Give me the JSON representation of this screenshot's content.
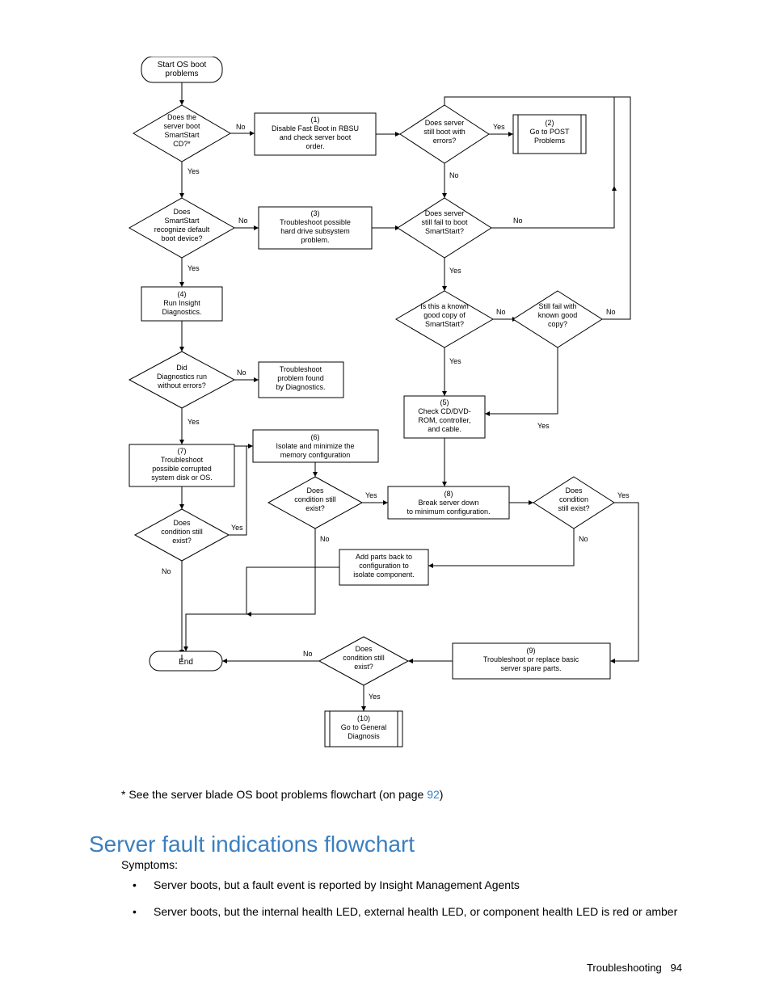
{
  "flow": {
    "start": "Start OS boot\nproblems",
    "q_boot_cd": "Does the\nserver boot\nSmartStart\nCD?*",
    "proc_disable_fastboot": "(1)\nDisable Fast Boot in RBSU\nand check server boot\norder.",
    "q_errors": "Does server\nstill boot with\nerrors?",
    "proc_goto_post": "(2)\nGo to POST\nProblems",
    "q_recognize_boot": "Does\nSmartStart\nrecognize default\nboot device?",
    "proc_hdd": "(3)\nTroubleshoot possible\nhard drive subsystem\nproblem.",
    "q_fail_smartstart": "Does server\nstill fail to boot\nSmartStart?",
    "proc_run_diag": "(4)\nRun Insight\nDiagnostics.",
    "q_known_good": "Is this a known\ngood copy of\nSmartStart?",
    "q_still_fail_good": "Still fail with\nknown good\ncopy?",
    "q_diag_errors": "Did\nDiagnostics run\nwithout errors?",
    "proc_tshoot_diag": "Troubleshoot\nproblem found\nby Diagnostics.",
    "proc_check_cd": "(5)\nCheck CD/DVD-\nROM, controller,\nand cable.",
    "proc_isolate_mem": "(6)\nIsolate and minimize the\nmemory configuration",
    "proc_tshoot_os": "(7)\nTroubleshoot\npossible corrupted\nsystem disk or OS.",
    "q_cond_still_1": "Does\ncondition still\nexist?",
    "proc_break_min": "(8)\nBreak server down\nto minimum configuration.",
    "q_cond_still_right": "Does\ncondition\nstill exist?",
    "q_cond_still_left": "Does\ncondition still\nexist?",
    "proc_add_parts": "Add parts back to\nconfiguration to\nisolate component.",
    "end": "End",
    "q_cond_still_bottom": "Does\ncondition still\nexist?",
    "proc_replace": "(9)\nTroubleshoot or replace basic\nserver spare parts.",
    "proc_goto_general": "(10)\nGo to General\nDiagnosis",
    "yes": "Yes",
    "no": "No"
  },
  "note_prefix": "* See the server blade OS boot problems flowchart (on page ",
  "note_link": "92",
  "note_suffix": ")",
  "heading": "Server fault indications flowchart",
  "symptoms_label": "Symptoms:",
  "bullet1": "Server boots, but a fault event is reported by Insight Management Agents",
  "bullet2": "Server boots, but the internal health LED, external health LED, or component health LED is red or amber",
  "footer_section": "Troubleshooting",
  "footer_page": "94"
}
